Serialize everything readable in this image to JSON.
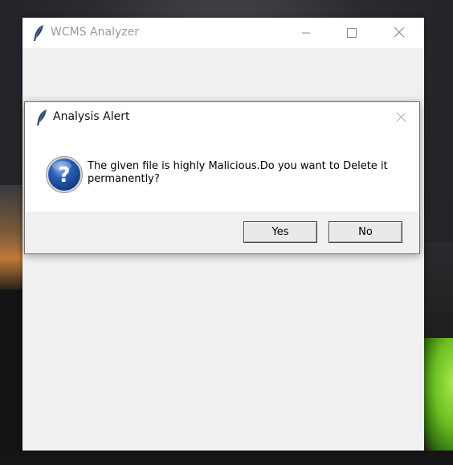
{
  "main_window": {
    "title": "WCMS Analyzer",
    "controls": {
      "minimize_icon": "minimize-icon",
      "maximize_icon": "maximize-icon",
      "close_icon": "close-icon"
    }
  },
  "dialog": {
    "title": "Analysis Alert",
    "icon": "question-icon",
    "message": "The given file is highly Malicious.Do you want to Delete it permanently?",
    "buttons": {
      "yes": "Yes",
      "no": "No"
    },
    "close_icon": "close-icon"
  },
  "colors": {
    "question_icon_blue": "#2a5fb8",
    "window_bg": "#f0f0f0",
    "titlebar_bg": "#ffffff"
  }
}
